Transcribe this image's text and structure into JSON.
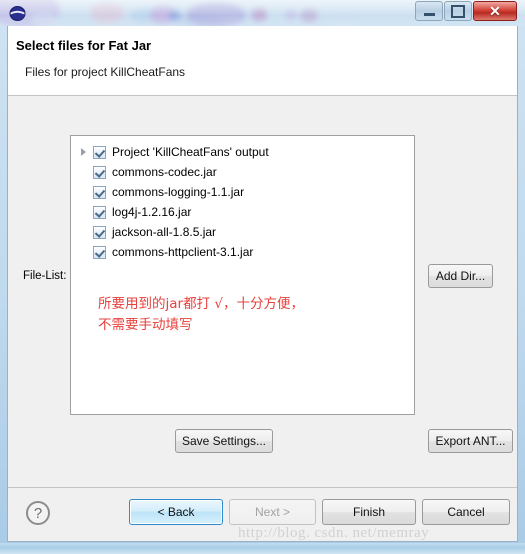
{
  "window": {
    "app_icon": "eclipse-icon",
    "controls": {
      "minimize": "–",
      "maximize": "□",
      "close": "✕"
    }
  },
  "header": {
    "title": "Select files for Fat Jar",
    "subtitle": "Files for project KillCheatFans"
  },
  "body": {
    "filelist_label": "File-List:",
    "files": [
      {
        "label": "Project 'KillCheatFans' output",
        "checked": true,
        "expandable": true
      },
      {
        "label": "commons-codec.jar",
        "checked": true,
        "expandable": false
      },
      {
        "label": "commons-logging-1.1.jar",
        "checked": true,
        "expandable": false
      },
      {
        "label": "log4j-1.2.16.jar",
        "checked": true,
        "expandable": false
      },
      {
        "label": "jackson-all-1.8.5.jar",
        "checked": true,
        "expandable": false
      },
      {
        "label": "commons-httpclient-3.1.jar",
        "checked": true,
        "expandable": false
      }
    ],
    "annotation": "所要用到的jar都打 √，十分方便，\n不需要手动填写",
    "annotation_color": "#e8413c",
    "add_dir_label": "Add Dir...",
    "save_settings_label": "Save Settings...",
    "export_ant_label": "Export ANT..."
  },
  "footer": {
    "help_label": "?",
    "back_label": "< Back",
    "next_label": "Next >",
    "finish_label": "Finish",
    "cancel_label": "Cancel"
  },
  "watermark": "http://blog. csdn. net/memray"
}
